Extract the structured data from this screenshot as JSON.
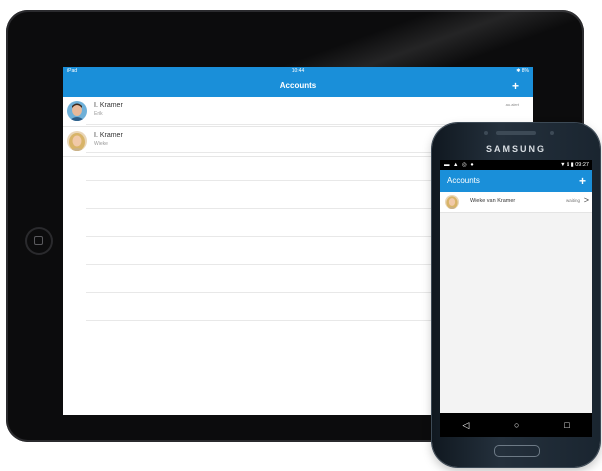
{
  "ipad": {
    "status": {
      "carrier": "iPad",
      "time": "10:44",
      "battery": "✱ 8%"
    },
    "nav": {
      "title": "Accounts",
      "add": "+"
    },
    "accounts": [
      {
        "name": "I. Kramer",
        "sub": "Erik",
        "status": "au.alert",
        "avatar": "man"
      },
      {
        "name": "I. Kramer",
        "sub": "Wieke",
        "status": "au.alert",
        "avatar": "woman"
      }
    ]
  },
  "phone": {
    "brand": "SAMSUNG",
    "status": {
      "icons": "▬ ▲ ◎ ●",
      "time": "▼ ℹ ▮ 09:27"
    },
    "nav": {
      "title": "Accounts",
      "add": "+"
    },
    "accounts": [
      {
        "name": "Wieke van Kramer",
        "status": "waiting",
        "chevron": ">",
        "avatar": "woman"
      }
    ],
    "softkeys": {
      "back": "◁",
      "home": "○",
      "recents": "□"
    }
  },
  "colors": {
    "accent": "#1a8fd9",
    "device_dark": "#0c0c0d"
  }
}
